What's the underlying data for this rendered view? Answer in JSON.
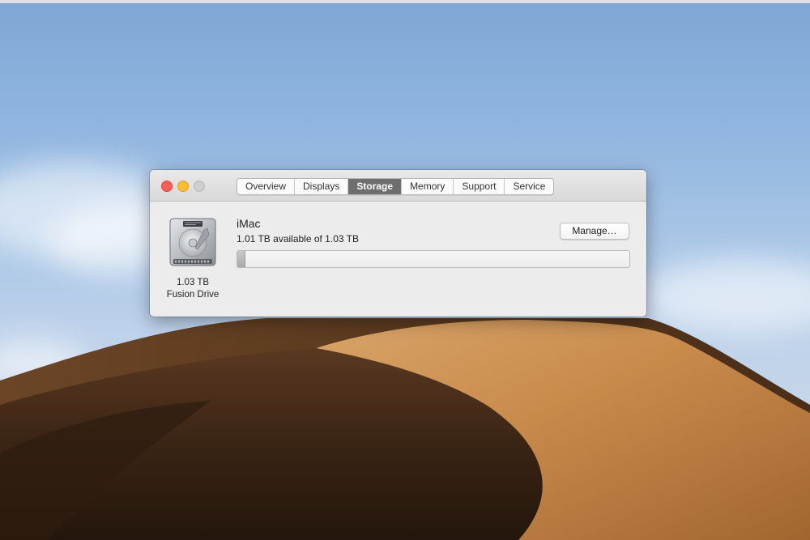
{
  "window": {
    "traffic_lights": [
      "close",
      "minimize",
      "zoom"
    ],
    "tabs": [
      {
        "label": "Overview",
        "active": false
      },
      {
        "label": "Displays",
        "active": false
      },
      {
        "label": "Storage",
        "active": true
      },
      {
        "label": "Memory",
        "active": false
      },
      {
        "label": "Support",
        "active": false
      },
      {
        "label": "Service",
        "active": false
      }
    ]
  },
  "storage": {
    "drive_icon": "hard-drive-icon",
    "drive_capacity": "1.03 TB",
    "drive_type": "Fusion Drive",
    "volume_name": "iMac",
    "available_text": "1.01 TB available of 1.03 TB",
    "manage_label": "Manage…",
    "used_fraction": 0.019
  },
  "colors": {
    "close": "#fd5e57",
    "minimize": "#febc2e",
    "zoom": "#cfcfcf",
    "active_tab": "#6e6e6e"
  }
}
